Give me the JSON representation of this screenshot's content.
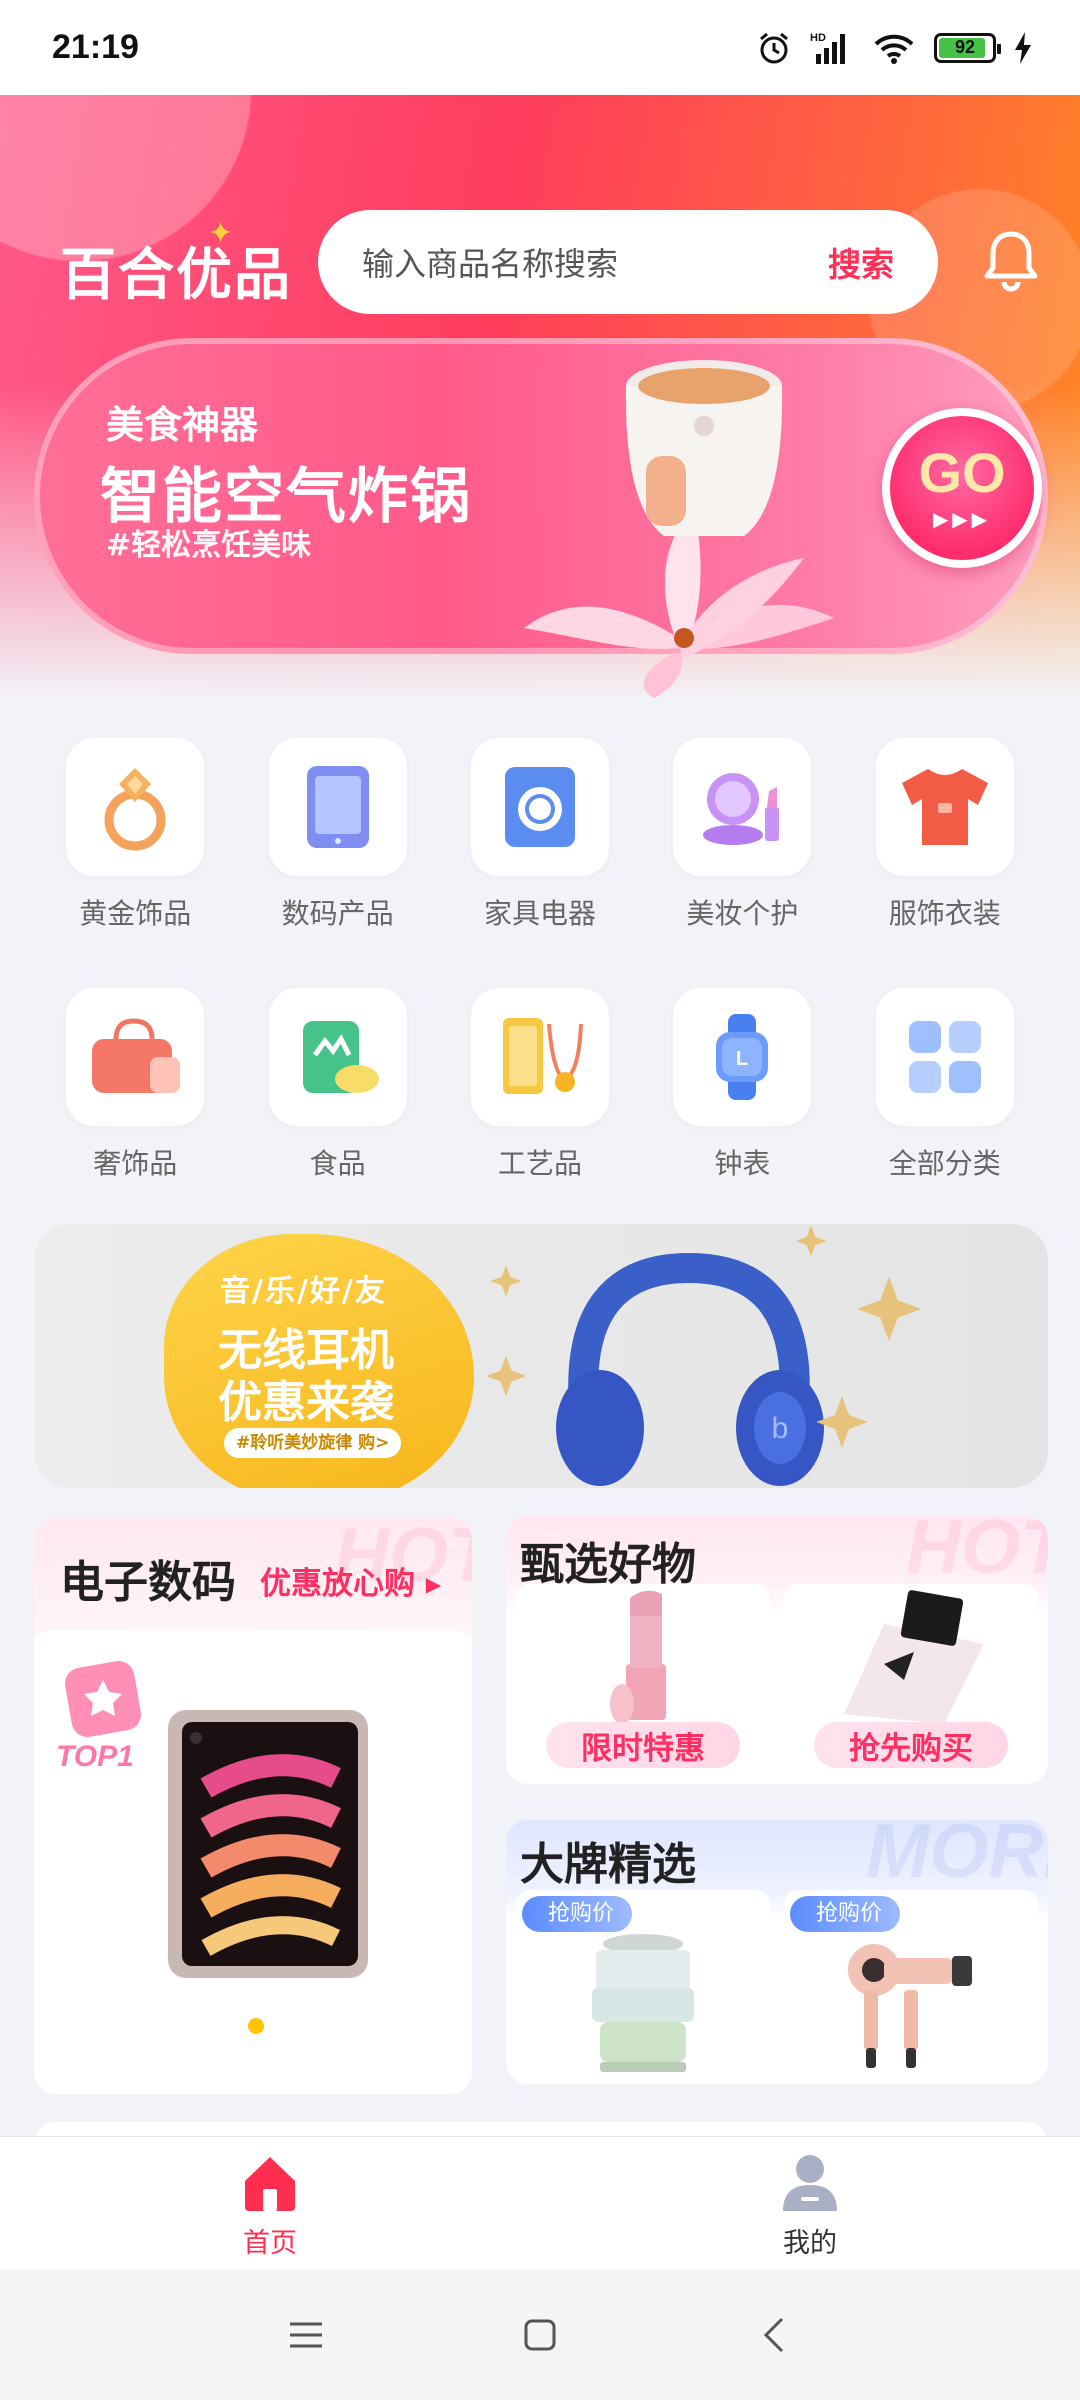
{
  "status_bar": {
    "time": "21:19",
    "battery": "92",
    "signal_label": "HD"
  },
  "header": {
    "logo": "百合优品",
    "search": {
      "placeholder": "输入商品名称搜索",
      "button": "搜索"
    }
  },
  "banner": {
    "subtitle": "美食神器",
    "title": "智能空气炸锅",
    "tag": "#轻松烹饪美味",
    "go": "GO",
    "go_arrows": "▶▶▶"
  },
  "categories": [
    {
      "label": "黄金饰品",
      "icon": "gold-ring-icon"
    },
    {
      "label": "数码产品",
      "icon": "tablet-icon"
    },
    {
      "label": "家具电器",
      "icon": "washing-machine-icon"
    },
    {
      "label": "美妆个护",
      "icon": "cosmetics-icon"
    },
    {
      "label": "服饰衣装",
      "icon": "tshirt-icon"
    },
    {
      "label": "奢饰品",
      "icon": "handbag-icon"
    },
    {
      "label": "食品",
      "icon": "food-pack-icon"
    },
    {
      "label": "工艺品",
      "icon": "gold-bar-icon"
    },
    {
      "label": "钟表",
      "icon": "watch-icon"
    },
    {
      "label": "全部分类",
      "icon": "grid-icon"
    }
  ],
  "promo": {
    "tag": "音/乐/好/友",
    "title_line1": "无线耳机",
    "title_line2": "优惠来袭",
    "pill": "#聆听美妙旋律 购>"
  },
  "electronics": {
    "title": "电子数码",
    "subtitle": "优惠放心购 ▸",
    "watermark": "HOT",
    "badge": "TOP1"
  },
  "selected": {
    "title": "甄选好物",
    "watermark": "HOT",
    "items": [
      {
        "label": "限时特惠"
      },
      {
        "label": "抢先购买"
      }
    ]
  },
  "brand": {
    "title": "大牌精选",
    "watermark": "MORE",
    "items": [
      {
        "tag": "抢购价"
      },
      {
        "tag": "抢购价"
      }
    ]
  },
  "tab_bar": {
    "tabs": [
      {
        "label": "首页",
        "active": true
      },
      {
        "label": "我的",
        "active": false
      }
    ]
  },
  "colors": {
    "accent": "#ff2e4e",
    "brand_pink": "#ff3158",
    "banner_pink": "#ff5a8a"
  }
}
